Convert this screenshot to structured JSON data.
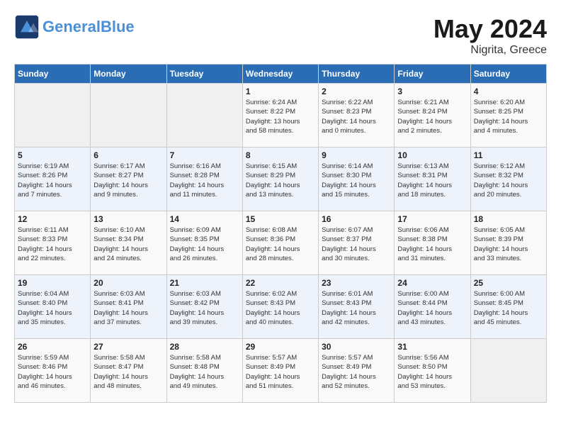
{
  "header": {
    "logo_line1": "General",
    "logo_line2": "Blue",
    "month_year": "May 2024",
    "location": "Nigrita, Greece"
  },
  "weekdays": [
    "Sunday",
    "Monday",
    "Tuesday",
    "Wednesday",
    "Thursday",
    "Friday",
    "Saturday"
  ],
  "weeks": [
    [
      {
        "day": "",
        "info": ""
      },
      {
        "day": "",
        "info": ""
      },
      {
        "day": "",
        "info": ""
      },
      {
        "day": "1",
        "info": "Sunrise: 6:24 AM\nSunset: 8:22 PM\nDaylight: 13 hours\nand 58 minutes."
      },
      {
        "day": "2",
        "info": "Sunrise: 6:22 AM\nSunset: 8:23 PM\nDaylight: 14 hours\nand 0 minutes."
      },
      {
        "day": "3",
        "info": "Sunrise: 6:21 AM\nSunset: 8:24 PM\nDaylight: 14 hours\nand 2 minutes."
      },
      {
        "day": "4",
        "info": "Sunrise: 6:20 AM\nSunset: 8:25 PM\nDaylight: 14 hours\nand 4 minutes."
      }
    ],
    [
      {
        "day": "5",
        "info": "Sunrise: 6:19 AM\nSunset: 8:26 PM\nDaylight: 14 hours\nand 7 minutes."
      },
      {
        "day": "6",
        "info": "Sunrise: 6:17 AM\nSunset: 8:27 PM\nDaylight: 14 hours\nand 9 minutes."
      },
      {
        "day": "7",
        "info": "Sunrise: 6:16 AM\nSunset: 8:28 PM\nDaylight: 14 hours\nand 11 minutes."
      },
      {
        "day": "8",
        "info": "Sunrise: 6:15 AM\nSunset: 8:29 PM\nDaylight: 14 hours\nand 13 minutes."
      },
      {
        "day": "9",
        "info": "Sunrise: 6:14 AM\nSunset: 8:30 PM\nDaylight: 14 hours\nand 15 minutes."
      },
      {
        "day": "10",
        "info": "Sunrise: 6:13 AM\nSunset: 8:31 PM\nDaylight: 14 hours\nand 18 minutes."
      },
      {
        "day": "11",
        "info": "Sunrise: 6:12 AM\nSunset: 8:32 PM\nDaylight: 14 hours\nand 20 minutes."
      }
    ],
    [
      {
        "day": "12",
        "info": "Sunrise: 6:11 AM\nSunset: 8:33 PM\nDaylight: 14 hours\nand 22 minutes."
      },
      {
        "day": "13",
        "info": "Sunrise: 6:10 AM\nSunset: 8:34 PM\nDaylight: 14 hours\nand 24 minutes."
      },
      {
        "day": "14",
        "info": "Sunrise: 6:09 AM\nSunset: 8:35 PM\nDaylight: 14 hours\nand 26 minutes."
      },
      {
        "day": "15",
        "info": "Sunrise: 6:08 AM\nSunset: 8:36 PM\nDaylight: 14 hours\nand 28 minutes."
      },
      {
        "day": "16",
        "info": "Sunrise: 6:07 AM\nSunset: 8:37 PM\nDaylight: 14 hours\nand 30 minutes."
      },
      {
        "day": "17",
        "info": "Sunrise: 6:06 AM\nSunset: 8:38 PM\nDaylight: 14 hours\nand 31 minutes."
      },
      {
        "day": "18",
        "info": "Sunrise: 6:05 AM\nSunset: 8:39 PM\nDaylight: 14 hours\nand 33 minutes."
      }
    ],
    [
      {
        "day": "19",
        "info": "Sunrise: 6:04 AM\nSunset: 8:40 PM\nDaylight: 14 hours\nand 35 minutes."
      },
      {
        "day": "20",
        "info": "Sunrise: 6:03 AM\nSunset: 8:41 PM\nDaylight: 14 hours\nand 37 minutes."
      },
      {
        "day": "21",
        "info": "Sunrise: 6:03 AM\nSunset: 8:42 PM\nDaylight: 14 hours\nand 39 minutes."
      },
      {
        "day": "22",
        "info": "Sunrise: 6:02 AM\nSunset: 8:43 PM\nDaylight: 14 hours\nand 40 minutes."
      },
      {
        "day": "23",
        "info": "Sunrise: 6:01 AM\nSunset: 8:43 PM\nDaylight: 14 hours\nand 42 minutes."
      },
      {
        "day": "24",
        "info": "Sunrise: 6:00 AM\nSunset: 8:44 PM\nDaylight: 14 hours\nand 43 minutes."
      },
      {
        "day": "25",
        "info": "Sunrise: 6:00 AM\nSunset: 8:45 PM\nDaylight: 14 hours\nand 45 minutes."
      }
    ],
    [
      {
        "day": "26",
        "info": "Sunrise: 5:59 AM\nSunset: 8:46 PM\nDaylight: 14 hours\nand 46 minutes."
      },
      {
        "day": "27",
        "info": "Sunrise: 5:58 AM\nSunset: 8:47 PM\nDaylight: 14 hours\nand 48 minutes."
      },
      {
        "day": "28",
        "info": "Sunrise: 5:58 AM\nSunset: 8:48 PM\nDaylight: 14 hours\nand 49 minutes."
      },
      {
        "day": "29",
        "info": "Sunrise: 5:57 AM\nSunset: 8:49 PM\nDaylight: 14 hours\nand 51 minutes."
      },
      {
        "day": "30",
        "info": "Sunrise: 5:57 AM\nSunset: 8:49 PM\nDaylight: 14 hours\nand 52 minutes."
      },
      {
        "day": "31",
        "info": "Sunrise: 5:56 AM\nSunset: 8:50 PM\nDaylight: 14 hours\nand 53 minutes."
      },
      {
        "day": "",
        "info": ""
      }
    ]
  ]
}
